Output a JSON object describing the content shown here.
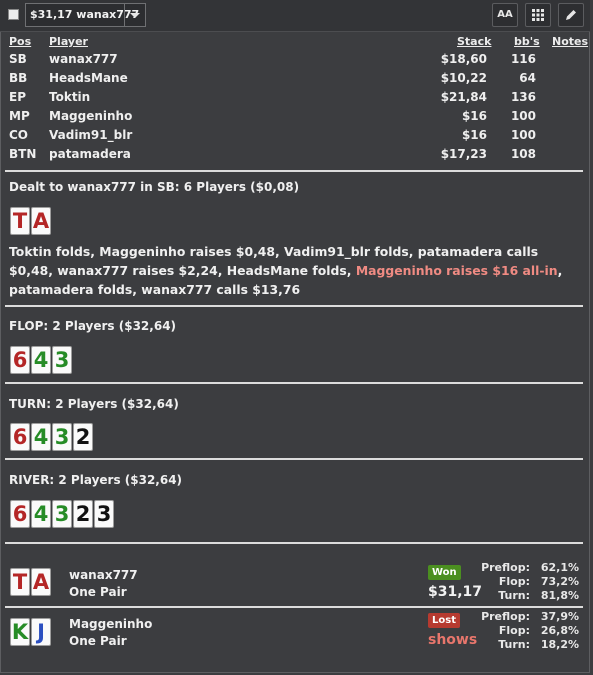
{
  "toolbar": {
    "selected_hand": "$31,17 wanax777",
    "font_button": "AA",
    "grid_button": "",
    "edit_button": ""
  },
  "table": {
    "headers": {
      "pos": "Pos",
      "player": "Player",
      "stack": "Stack",
      "bbs": "bb's",
      "notes": "Notes"
    },
    "rows": [
      {
        "pos": "SB",
        "name": "wanax777",
        "stack": "$18,60",
        "bb": "116"
      },
      {
        "pos": "BB",
        "name": "HeadsMane",
        "stack": "$10,22",
        "bb": "64"
      },
      {
        "pos": "EP",
        "name": "Toktin",
        "stack": "$21,84",
        "bb": "136"
      },
      {
        "pos": "MP",
        "name": "Maggeninho",
        "stack": "$16",
        "bb": "100"
      },
      {
        "pos": "CO",
        "name": "Vadim91_blr",
        "stack": "$16",
        "bb": "100"
      },
      {
        "pos": "BTN",
        "name": "patamadera",
        "stack": "$17,23",
        "bb": "108"
      }
    ]
  },
  "preflop": {
    "title": "Dealt to wanax777 in SB: 6 Players ($0,08)",
    "hole_cards": [
      {
        "rank": "T",
        "suit": "hearts"
      },
      {
        "rank": "A",
        "suit": "hearts"
      }
    ],
    "actions_a": "Toktin folds, Maggeninho raises $0,48, Vadim91_blr folds, patamadera calls $0,48, wanax777 raises $2,24, HeadsMane folds, ",
    "actions_highlight": "Maggeninho raises $16 all-in",
    "actions_b": ", patamadera folds, wanax777 calls $13,76"
  },
  "flop": {
    "title": "FLOP: 2 Players ($32,64)",
    "cards": [
      {
        "rank": "6",
        "suit": "hearts"
      },
      {
        "rank": "4",
        "suit": "clubs"
      },
      {
        "rank": "3",
        "suit": "clubs"
      }
    ]
  },
  "turn": {
    "title": "TURN: 2 Players ($32,64)",
    "cards": [
      {
        "rank": "6",
        "suit": "hearts"
      },
      {
        "rank": "4",
        "suit": "clubs"
      },
      {
        "rank": "3",
        "suit": "clubs"
      },
      {
        "rank": "2",
        "suit": "spades"
      }
    ]
  },
  "river": {
    "title": "RIVER: 2 Players ($32,64)",
    "cards": [
      {
        "rank": "6",
        "suit": "hearts"
      },
      {
        "rank": "4",
        "suit": "clubs"
      },
      {
        "rank": "3",
        "suit": "clubs"
      },
      {
        "rank": "2",
        "suit": "spades"
      },
      {
        "rank": "3",
        "suit": "spades"
      }
    ]
  },
  "results": [
    {
      "name": "wanax777",
      "hand": "One Pair",
      "cards": [
        {
          "rank": "T",
          "suit": "hearts"
        },
        {
          "rank": "A",
          "suit": "hearts"
        }
      ],
      "badge": "Won",
      "amount": "$31,17",
      "amount_color": "#f2f2f2",
      "equity": [
        {
          "label": "Preflop:",
          "value": "62,1%"
        },
        {
          "label": "Flop:",
          "value": "73,2%"
        },
        {
          "label": "Turn:",
          "value": "81,8%"
        }
      ]
    },
    {
      "name": "Maggeninho",
      "hand": "One Pair",
      "cards": [
        {
          "rank": "K",
          "suit": "clubs"
        },
        {
          "rank": "J",
          "suit": "diamonds"
        }
      ],
      "badge": "Lost",
      "amount": "shows",
      "amount_color": "#e8766c",
      "equity": [
        {
          "label": "Preflop:",
          "value": "37,9%"
        },
        {
          "label": "Flop:",
          "value": "26,8%"
        },
        {
          "label": "Turn:",
          "value": "18,2%"
        }
      ]
    }
  ],
  "colors": {
    "background": "#3c3d40",
    "highlight_action": "#f08b83",
    "won": "#4b8f20",
    "lost": "#b73a30"
  }
}
